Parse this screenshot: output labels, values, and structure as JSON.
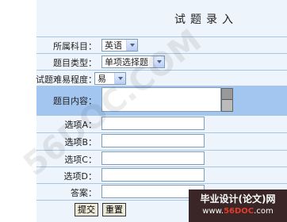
{
  "form": {
    "title": "试题录入",
    "subject": {
      "label": "所属科目：",
      "value": "英语"
    },
    "type": {
      "label": "题目类型：",
      "value": "单项选择题"
    },
    "difficulty": {
      "label": "试题难易程度：",
      "value": "易"
    },
    "content": {
      "label": "题目内容："
    },
    "option_a": {
      "label": "选项A："
    },
    "option_b": {
      "label": "选项B："
    },
    "option_c": {
      "label": "选项C："
    },
    "option_d": {
      "label": "选项D："
    },
    "answer": {
      "label": "答案："
    }
  },
  "buttons": {
    "submit": "提交",
    "reset": "重置"
  },
  "watermark": {
    "text": "56DOC.COM"
  },
  "badge": {
    "title": "毕业设计(论文)网",
    "url_prefix": "www.",
    "url_brand": "56DOC",
    "url_suffix": ".com"
  }
}
